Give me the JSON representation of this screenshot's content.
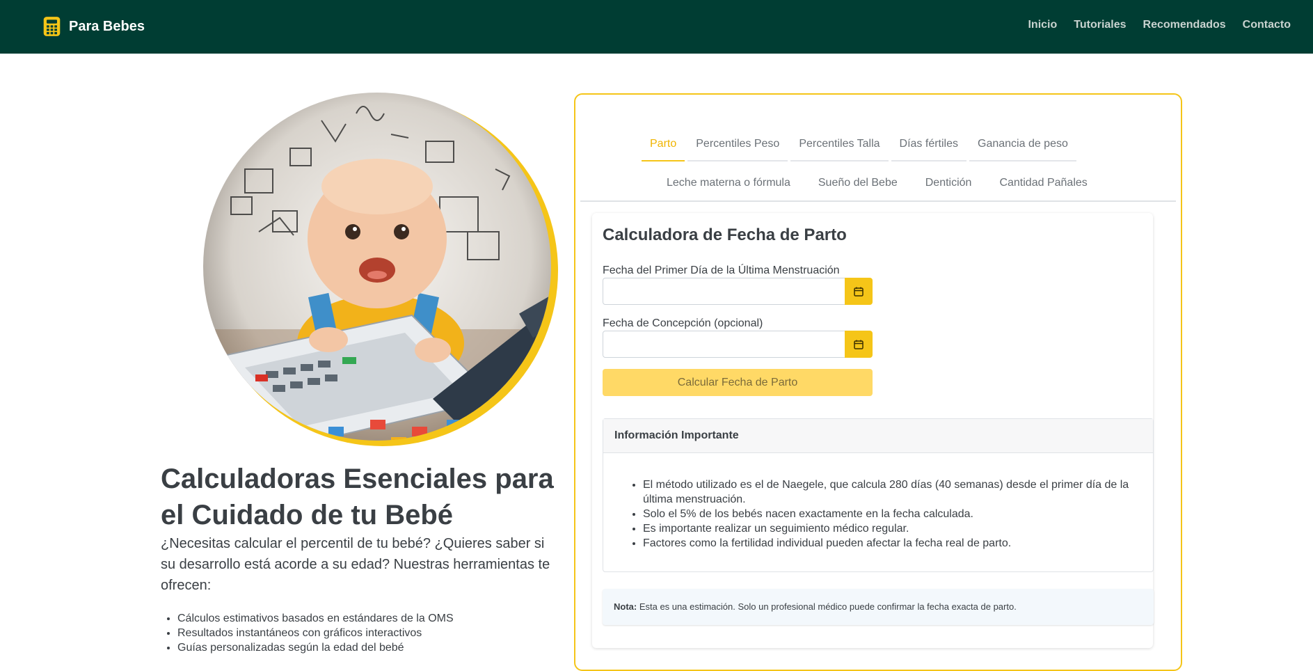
{
  "brand": {
    "name": "Para Bebes",
    "icon": "calculator-icon",
    "accent": "#f5c518",
    "nav_bg": "#003d33"
  },
  "nav": {
    "items": [
      "Inicio",
      "Tutoriales",
      "Recomendados",
      "Contacto"
    ]
  },
  "hero": {
    "image": "baby-with-calculators-image",
    "title": "Calculadoras Esenciales para el Cuidado de tu Bebé",
    "description": "¿Necesitas calcular el percentil de tu bebé? ¿Quieres saber si su desarrollo está acorde a su edad? Nuestras herramientas te ofrecen:",
    "features": [
      "Cálculos estimativos basados en estándares de la OMS",
      "Resultados instantáneos con gráficos interactivos",
      "Guías personalizadas según la edad del bebé"
    ]
  },
  "tabs": {
    "row1": [
      "Parto",
      "Percentiles Peso",
      "Percentiles Talla",
      "Días fértiles",
      "Ganancia de peso"
    ],
    "row2": [
      "Leche materna o fórmula",
      "Sueño del Bebe",
      "Dentición",
      "Cantidad Pañales"
    ],
    "active": "Parto"
  },
  "calculator": {
    "title": "Calculadora de Fecha de Parto",
    "field1_label": "Fecha del Primer Día de la Última Menstruación",
    "field1_value": "",
    "field2_label": "Fecha de Concepción (opcional)",
    "field2_value": "",
    "button_label": "Calcular Fecha de Parto"
  },
  "info": {
    "header": "Información Importante",
    "items": [
      "El método utilizado es el de Naegele, que calcula 280 días (40 semanas) desde el primer día de la última menstruación.",
      "Solo el 5% de los bebés nacen exactamente en la fecha calculada.",
      "Es importante realizar un seguimiento médico regular.",
      "Factores como la fertilidad individual pueden afectar la fecha real de parto."
    ]
  },
  "note": {
    "label": "Nota:",
    "text": " Esta es una estimación. Solo un profesional médico puede confirmar la fecha exacta de parto."
  }
}
